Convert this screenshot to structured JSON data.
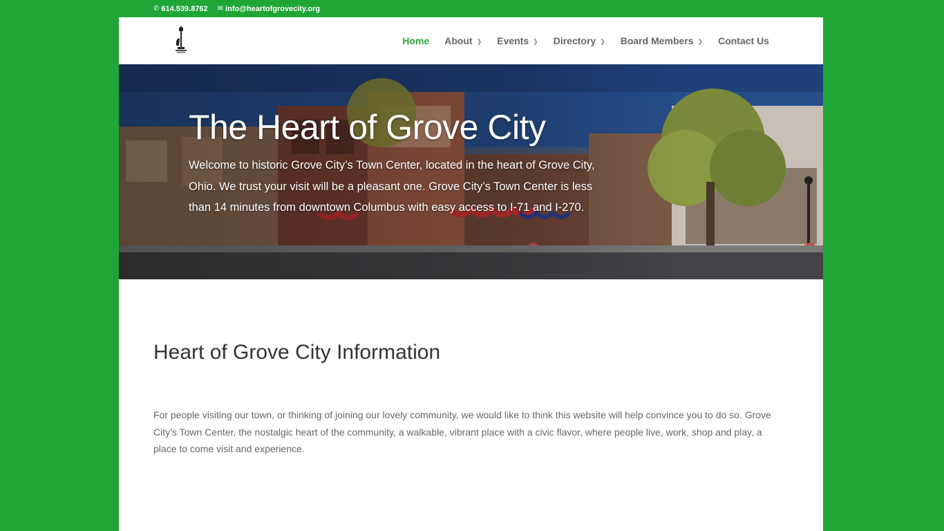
{
  "topbar": {
    "phone": "614.539.8762",
    "email": "info@heartofgrovecity.org",
    "phone_icon": "phone-icon",
    "email_icon": "envelope-icon"
  },
  "nav": {
    "items": [
      {
        "label": "Home",
        "active": true,
        "dropdown": false
      },
      {
        "label": "About",
        "active": false,
        "dropdown": true
      },
      {
        "label": "Events",
        "active": false,
        "dropdown": true
      },
      {
        "label": "Directory",
        "active": false,
        "dropdown": true
      },
      {
        "label": "Board Members",
        "active": false,
        "dropdown": true
      },
      {
        "label": "Contact Us",
        "active": false,
        "dropdown": false
      }
    ],
    "active_color": "#2ea43c"
  },
  "hero": {
    "title": "The Heart of Grove City",
    "text": "Welcome to historic Grove City’s Town Center, located in the heart of Grove City, Ohio. We trust your visit will be a pleasant one. Grove City’s Town Center is less than 14 minutes from downtown Columbus with easy access to I-71 and I-270."
  },
  "info": {
    "title": "Heart of Grove City Information",
    "text": "For people visiting our town, or thinking of joining our lovely community, we would like to think this website will help convince you to do so. Grove City’s Town Center, the nostalgic heart of the community, a walkable, vibrant place with a civic flavor, where people live, work, shop and play, a place to come visit and experience."
  },
  "colors": {
    "background": "#1fa637",
    "accent": "#2ea43c"
  }
}
